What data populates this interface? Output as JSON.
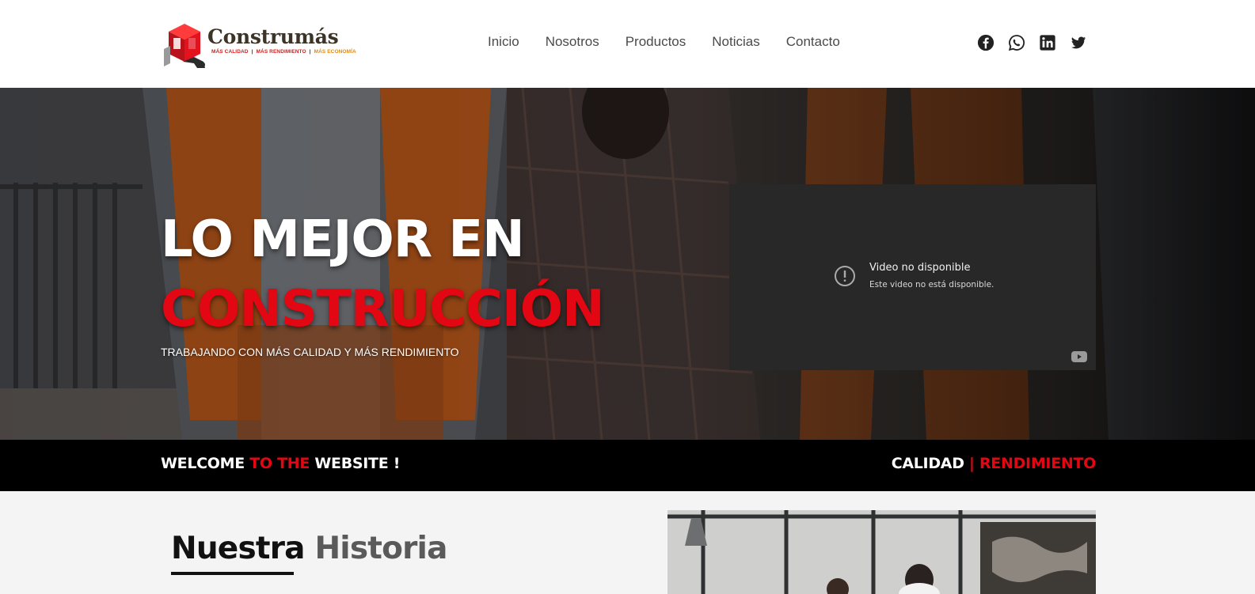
{
  "header": {
    "logo": {
      "name": "Construmás",
      "tagline_1": "MÁS CALIDAD",
      "tagline_sep": "|",
      "tagline_2": "MÁS RENDIMIENTO",
      "tagline_3": "MÁS ECONOMÍA"
    },
    "nav": [
      "Inicio",
      "Nosotros",
      "Productos",
      "Noticias",
      "Contacto"
    ],
    "social_icons": [
      "facebook-icon",
      "whatsapp-icon",
      "linkedin-icon",
      "twitter-icon"
    ]
  },
  "hero": {
    "title_line_1": "LO MEJOR EN",
    "title_line_2": "CONSTRUCCIÓN",
    "subtitle": "TRABAJANDO CON MÁS CALIDAD Y MÁS RENDIMIENTO",
    "video": {
      "title": "Video no disponible",
      "message": "Este video no está disponible."
    }
  },
  "strip": {
    "left_1": "WELCOME",
    "left_2": "TO THE",
    "left_3": "WEBSITE !",
    "right_1": "CALIDAD",
    "right_2": "| RENDIMIENTO"
  },
  "history": {
    "title_1": "Nuestra",
    "title_2": "Historia"
  },
  "colors": {
    "accent": "#e30613",
    "dark": "#000000",
    "text": "#4a4a4a",
    "video_bg": "#282828"
  }
}
